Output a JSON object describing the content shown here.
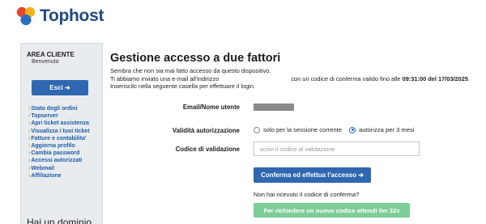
{
  "brand": {
    "name": "Tophost"
  },
  "sidebar": {
    "title": "AREA CLIENTE",
    "welcome": "Benvenuto",
    "exit_label": "Esci ➔",
    "items": [
      {
        "label": "Stato degli ordini"
      },
      {
        "label": "Topserver"
      },
      {
        "label": "Apri ticket assistenza"
      },
      {
        "label": "Visualizza i tuoi ticket"
      },
      {
        "label": "Fatture e contabilita'"
      },
      {
        "label": "Aggiorna profilo"
      },
      {
        "label": "Cambia password"
      },
      {
        "label": "Accessi autorizzati"
      },
      {
        "label": "Webmail"
      },
      {
        "label": "Affiliazione"
      }
    ],
    "promo_heading": "Hai un dominio"
  },
  "main": {
    "title": "Gestione accesso a due fattori",
    "intro_line1": "Sembra che non sia mai fatto accesso da questo dispositivo.",
    "intro_line2_a": "Ti abbiamo inviato una e-mail all'indirizzo",
    "intro_line2_b": "con un codice di conferma valido fino alle",
    "intro_line2_time": "09:31:00 del 17/03/2025",
    "intro_line3": "Inseriscilo nella seguente casella per effettuare il login.",
    "email_label": "Email/Nome utente",
    "validity_label": "Validità autorizzazione",
    "validity_options": [
      {
        "label": "solo per la sessione corrente",
        "checked": false
      },
      {
        "label": "autorizza per 3 mesi",
        "checked": true
      }
    ],
    "code_label": "Codice di validazione",
    "code_placeholder": "scrivi il codice di validazione",
    "confirm_label": "Conferma ed effettua l'accesso ➔",
    "no_code_text": "Non hai ricevuto il codice di conferma?",
    "resend_label": "Per richiedere un nuovo codice attendi 0m 32s"
  },
  "colors": {
    "primary_button": "#2f68b0",
    "resend_button": "#7dcd97",
    "link": "#1f5ca8",
    "link_arrow": "#e39b1c"
  }
}
